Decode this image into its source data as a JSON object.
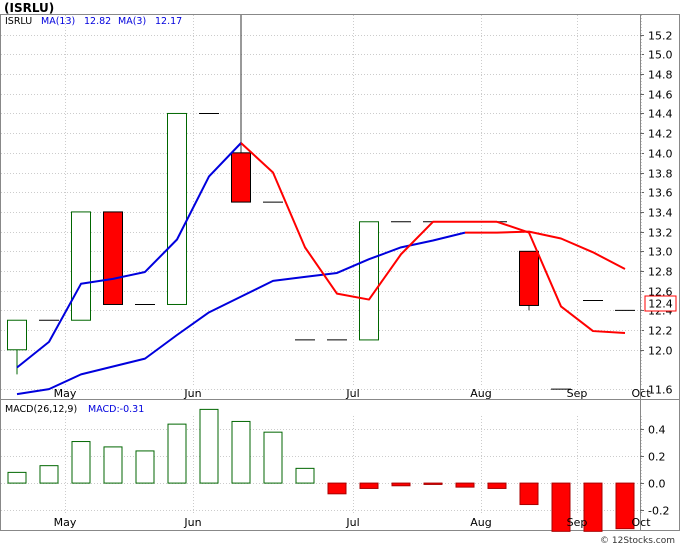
{
  "ticker_title": "(ISRLU)",
  "watermark": "© 12Stocks.com",
  "chart_data": [
    {
      "type": "candlestick",
      "panel": "price",
      "symbol_label": "ISRLU",
      "ma13_label": "MA(13)",
      "ma13_value": "12.82",
      "ma3_label": "MA(3)",
      "ma3_value": "12.17",
      "last_price_label": "12.4",
      "ylim": [
        11.5,
        15.4
      ],
      "y_ticks": [
        11.6,
        12.0,
        12.2,
        12.4,
        12.6,
        12.8,
        13.0,
        13.2,
        13.4,
        13.6,
        13.8,
        14.0,
        14.2,
        14.4,
        14.6,
        14.8,
        15.0,
        15.2
      ],
      "y_tick_labels": [
        "11.6",
        "12.0",
        "12.2",
        "12.4",
        "12.6",
        "12.8",
        "13.0",
        "13.2",
        "13.4",
        "13.6",
        "13.8",
        "14.0",
        "14.2",
        "14.4",
        "14.6",
        "14.8",
        "15.0",
        "15.2"
      ],
      "x_labels": [
        "May",
        "Jun",
        "Jul",
        "Aug",
        "Sep",
        "Oct"
      ],
      "x_label_positions": [
        1.5,
        5.5,
        10.5,
        14.5,
        17.5,
        19.5
      ],
      "grid_lines_at": [
        1.5,
        5.5,
        10.5,
        14.5,
        17.5,
        19.5
      ],
      "bars": [
        {
          "o": 12.0,
          "h": 12.3,
          "l": 11.75,
          "c": 12.3
        },
        {
          "o": 12.3,
          "h": 12.3,
          "l": 12.3,
          "c": 12.3
        },
        {
          "o": 12.3,
          "h": 13.4,
          "l": 12.3,
          "c": 13.4
        },
        {
          "o": 13.4,
          "h": 13.4,
          "l": 12.46,
          "c": 12.46
        },
        {
          "o": 12.46,
          "h": 12.46,
          "l": 12.46,
          "c": 12.46
        },
        {
          "o": 12.46,
          "h": 14.4,
          "l": 12.46,
          "c": 14.4
        },
        {
          "o": 14.4,
          "h": 14.4,
          "l": 14.4,
          "c": 14.4
        },
        {
          "o": 14.0,
          "h": 15.4,
          "l": 13.5,
          "c": 13.5
        },
        {
          "o": 13.5,
          "h": 13.5,
          "l": 13.5,
          "c": 13.5
        },
        {
          "o": 12.1,
          "h": 12.1,
          "l": 12.1,
          "c": 12.1
        },
        {
          "o": 12.1,
          "h": 12.1,
          "l": 12.1,
          "c": 12.1
        },
        {
          "o": 12.1,
          "h": 13.3,
          "l": 12.1,
          "c": 13.3
        },
        {
          "o": 13.3,
          "h": 13.3,
          "l": 13.3,
          "c": 13.3
        },
        {
          "o": 13.3,
          "h": 13.3,
          "l": 13.3,
          "c": 13.3
        },
        {
          "o": 13.3,
          "h": 13.3,
          "l": 13.3,
          "c": 13.3
        },
        {
          "o": 13.3,
          "h": 13.3,
          "l": 13.3,
          "c": 13.3
        },
        {
          "o": 13.0,
          "h": 13.0,
          "l": 12.4,
          "c": 12.45
        },
        {
          "o": 11.6,
          "h": 11.6,
          "l": 11.6,
          "c": 11.6
        },
        {
          "o": 12.5,
          "h": 12.5,
          "l": 12.5,
          "c": 12.5
        },
        {
          "o": 12.4,
          "h": 12.4,
          "l": 12.4,
          "c": 12.4
        }
      ],
      "series": [
        {
          "name": "MA(13)",
          "color": "#0000dd",
          "points": [
            [
              0,
              11.55
            ],
            [
              1,
              11.6
            ],
            [
              2,
              11.75
            ],
            [
              3,
              11.83
            ],
            [
              4,
              11.91
            ],
            [
              5,
              12.15
            ],
            [
              6,
              12.38
            ],
            [
              7,
              12.54
            ],
            [
              8,
              12.7
            ],
            [
              9,
              12.74
            ],
            [
              10,
              12.78
            ],
            [
              11,
              12.92
            ],
            [
              12,
              13.04
            ],
            [
              13,
              13.11
            ],
            [
              14,
              13.19
            ]
          ]
        },
        {
          "name": "MA(3)",
          "color": "#0000dd",
          "points": [
            [
              0,
              11.82
            ],
            [
              1,
              12.08
            ],
            [
              2,
              12.67
            ],
            [
              3,
              12.72
            ],
            [
              4,
              12.79
            ],
            [
              5,
              13.12
            ],
            [
              6,
              13.76
            ],
            [
              7,
              14.1
            ]
          ]
        },
        {
          "name": "MA(3)",
          "color": "#ff0000",
          "points": [
            [
              7,
              14.1
            ],
            [
              8,
              13.8
            ],
            [
              9,
              13.04
            ],
            [
              10,
              12.57
            ],
            [
              11,
              12.51
            ],
            [
              12,
              12.97
            ],
            [
              13,
              13.3
            ],
            [
              14,
              13.3
            ],
            [
              15,
              13.3
            ]
          ]
        },
        {
          "name": "MA(3)",
          "color": "#ff0000",
          "points": [
            [
              15,
              13.3
            ],
            [
              16,
              13.19
            ],
            [
              17,
              12.44
            ],
            [
              18,
              12.19
            ],
            [
              19,
              12.17
            ]
          ]
        },
        {
          "name": "MA(13)",
          "color": "#ff0000",
          "points": [
            [
              14,
              13.19
            ],
            [
              15,
              13.19
            ],
            [
              16,
              13.2
            ],
            [
              17,
              13.13
            ],
            [
              18,
              12.99
            ],
            [
              19,
              12.82
            ]
          ]
        }
      ]
    },
    {
      "type": "bar",
      "panel": "macd",
      "label": "MACD(26,12,9)",
      "value_label": "MACD:-0.31",
      "ylim": [
        -0.35,
        0.62
      ],
      "y_ticks": [
        -0.2,
        0.0,
        0.2,
        0.4
      ],
      "y_tick_labels": [
        "-0.2",
        "0.0",
        "0.2",
        "0.4"
      ],
      "x_labels": [
        "May",
        "Jun",
        "Jul",
        "Aug",
        "Sep",
        "Oct"
      ],
      "values": [
        0.08,
        0.13,
        0.31,
        0.27,
        0.24,
        0.44,
        0.55,
        0.46,
        0.38,
        0.11,
        -0.08,
        -0.04,
        -0.02,
        -0.01,
        -0.03,
        -0.04,
        -0.16,
        -0.36,
        -0.36,
        -0.34
      ]
    }
  ]
}
